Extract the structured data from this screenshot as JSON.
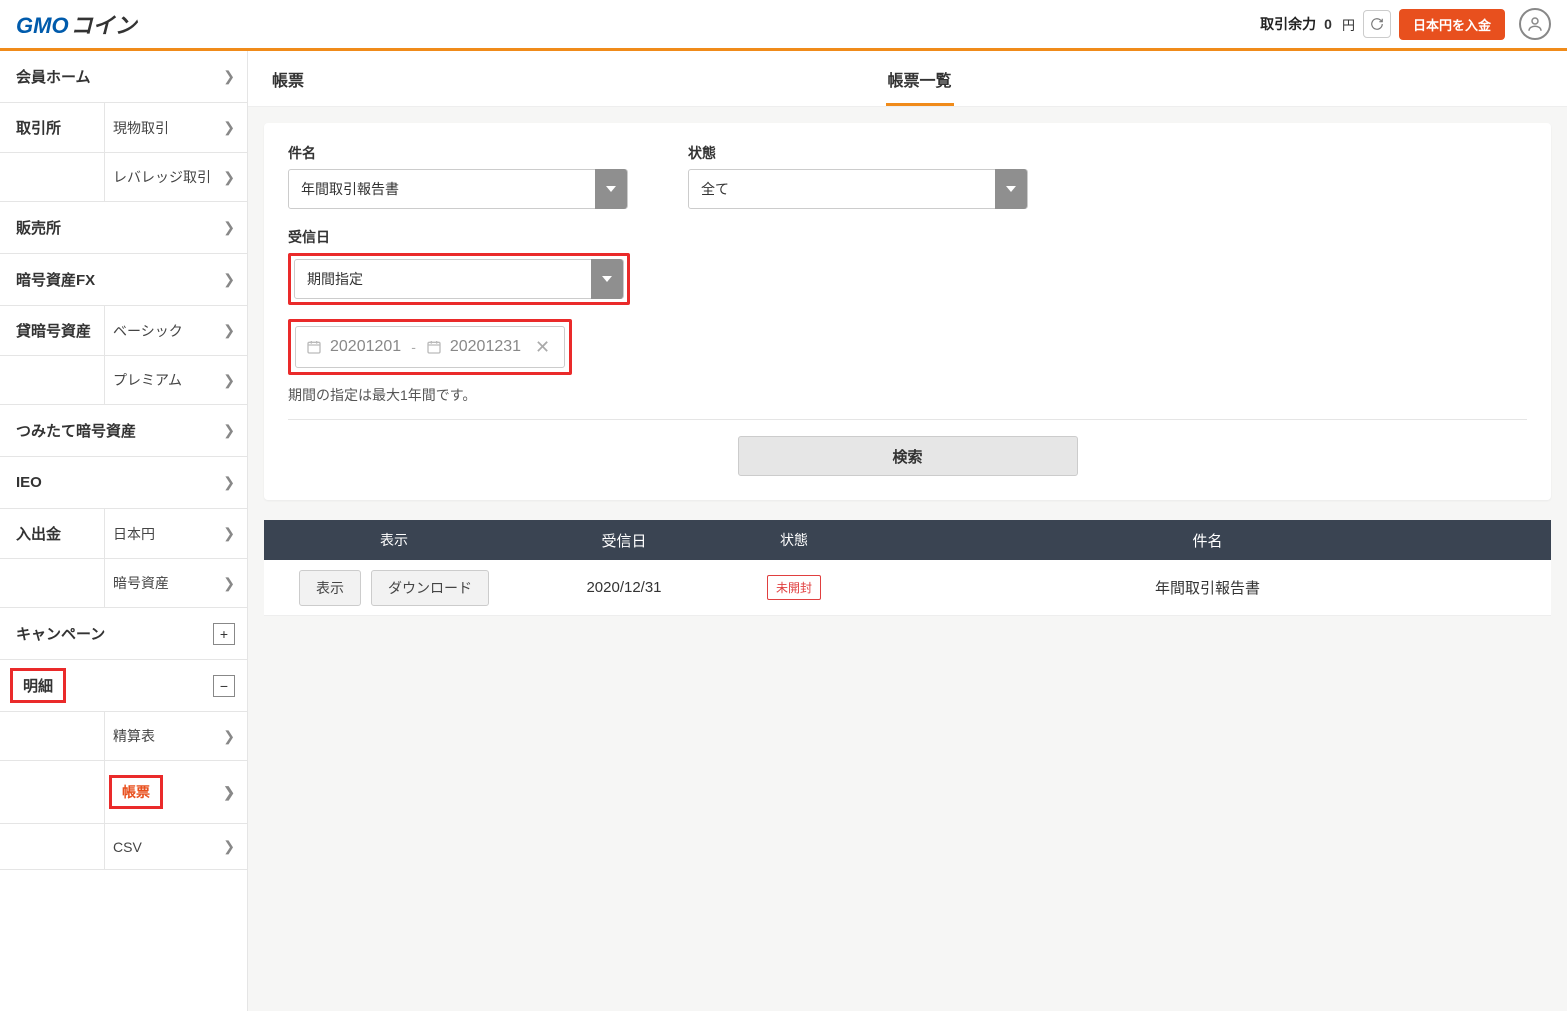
{
  "header": {
    "logo_gmo": "GMO",
    "logo_coin": "コイン",
    "balance_label": "取引余力",
    "balance_value": "0",
    "balance_unit": "円",
    "deposit_btn": "日本円を入金"
  },
  "sidebar": {
    "home": "会員ホーム",
    "exchange_cat": "取引所",
    "exchange_spot": "現物取引",
    "exchange_lev": "レバレッジ取引",
    "sales": "販売所",
    "cryptofx": "暗号資産FX",
    "lend_cat": "貸暗号資産",
    "lend_basic": "ベーシック",
    "lend_premium": "プレミアム",
    "accum": "つみたて暗号資産",
    "ieo": "IEO",
    "io_cat": "入出金",
    "io_jpy": "日本円",
    "io_crypto": "暗号資産",
    "campaign": "キャンペーン",
    "detail_cat": "明細",
    "detail_settlement": "精算表",
    "detail_report": "帳票",
    "detail_csv": "CSV"
  },
  "tabs": {
    "left": "帳票",
    "right": "帳票一覧"
  },
  "form": {
    "subject_label": "件名",
    "subject_value": "年間取引報告書",
    "state_label": "状態",
    "state_value": "全て",
    "recv_label": "受信日",
    "recv_value": "期間指定",
    "date_from": "20201201",
    "date_to": "20201231",
    "helper": "期間の指定は最大1年間です。",
    "search_btn": "検索"
  },
  "results": {
    "head_display": "表示",
    "head_date": "受信日",
    "head_state": "状態",
    "head_subject": "件名",
    "row": {
      "display_btn": "表示",
      "download_btn": "ダウンロード",
      "date": "2020/12/31",
      "state": "未開封",
      "subject": "年間取引報告書"
    }
  }
}
